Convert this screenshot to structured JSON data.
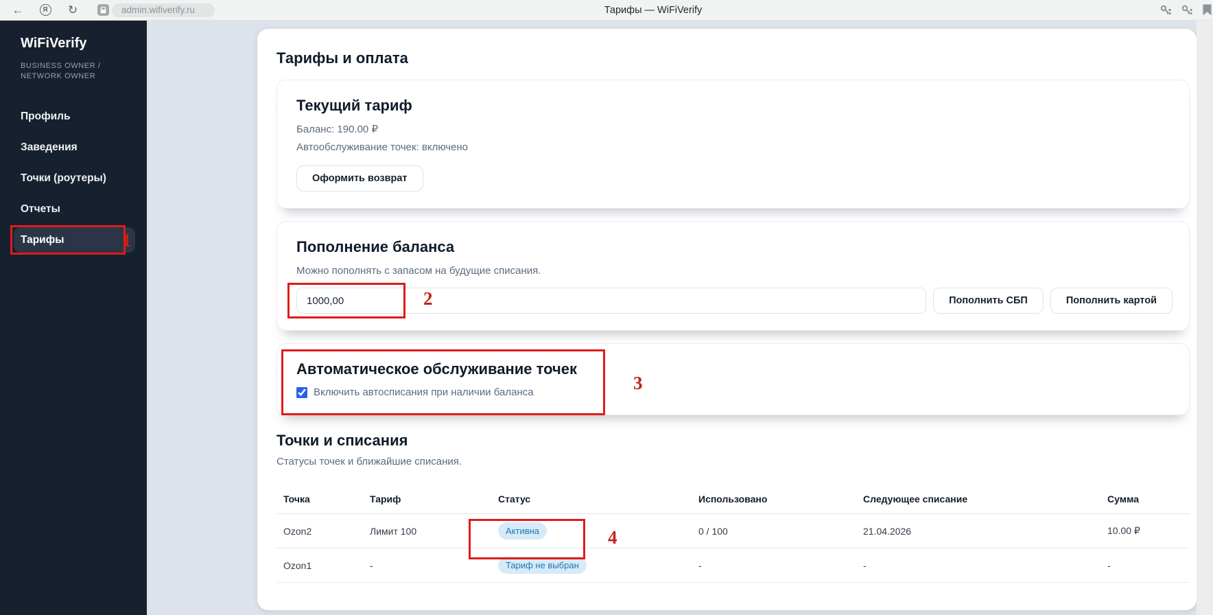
{
  "browser": {
    "url": "admin.wifiverify.ru",
    "title": "Тарифы — WiFiVerify"
  },
  "sidebar": {
    "brand": "WiFiVerify",
    "role": "BUSINESS OWNER / NETWORK OWNER",
    "items": [
      {
        "label": "Профиль"
      },
      {
        "label": "Заведения"
      },
      {
        "label": "Точки (роутеры)"
      },
      {
        "label": "Отчеты"
      },
      {
        "label": "Тарифы"
      }
    ],
    "active_item": "Тарифы"
  },
  "page": {
    "title": "Тарифы и оплата"
  },
  "current_tariff": {
    "title": "Текущий тариф",
    "balance": "Баланс: 190.00 ₽",
    "autoservice": "Автообслуживание точек: включено",
    "refund_button": "Оформить возврат"
  },
  "topup": {
    "title": "Пополнение баланса",
    "hint": "Можно пополнять с запасом на будущие списания.",
    "amount_value": "1000,00",
    "sbp_button": "Пополнить СБП",
    "card_button": "Пополнить картой"
  },
  "autoservice": {
    "title": "Автоматическое обслуживание точек",
    "checkbox_label": "Включить автосписания при наличии баланса",
    "checked": true
  },
  "points": {
    "title": "Точки и списания",
    "subtitle": "Статусы точек и ближайшие списания.",
    "columns": [
      "Точка",
      "Тариф",
      "Статус",
      "Использовано",
      "Следующее списание",
      "Сумма"
    ],
    "rows": [
      {
        "point": "Ozon2",
        "tariff": "Лимит 100",
        "status": "Активна",
        "used": "0 / 100",
        "next_charge": "21.04.2026",
        "amount": "10.00 ₽"
      },
      {
        "point": "Ozon1",
        "tariff": "-",
        "status": "Тариф не выбран",
        "used": "-",
        "next_charge": "-",
        "amount": "-"
      }
    ]
  },
  "annotations": {
    "n1": "1",
    "n2": "2",
    "n3": "3",
    "n4": "4"
  },
  "colors": {
    "annotation_red": "#e01b1b",
    "sidebar_bg": "#17202e",
    "badge_bg": "#d6eaf8",
    "badge_text": "#1f78b4",
    "checkbox_accent": "#2563eb",
    "content_bg": "#dde3ea"
  }
}
